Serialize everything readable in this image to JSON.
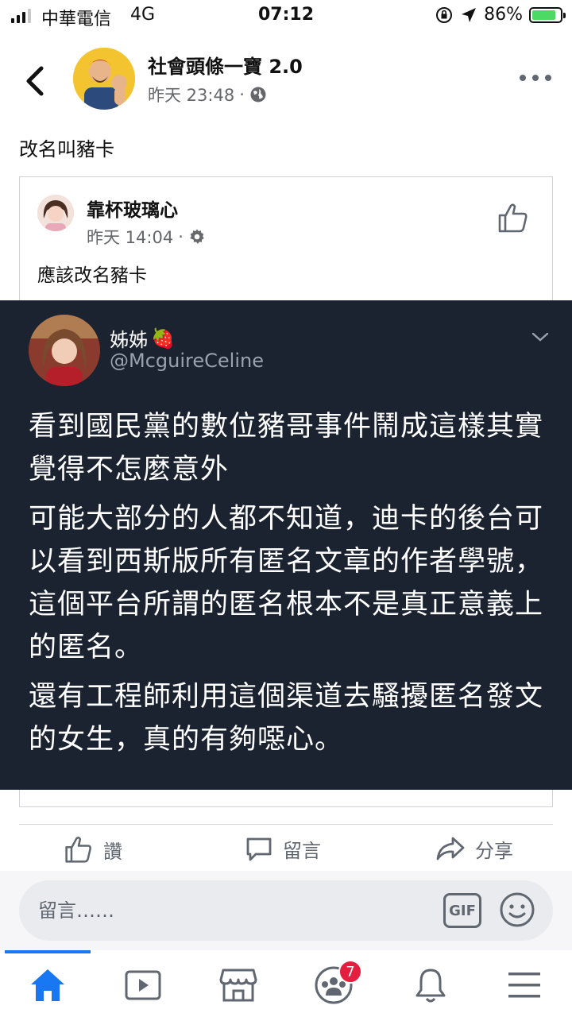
{
  "status_bar": {
    "carrier": "中華電信",
    "network": "4G",
    "time": "07:12",
    "battery_percent": "86%",
    "battery_level": 0.86,
    "signal_bars_on": 3
  },
  "post": {
    "page_name": "社會頭條一寶 2.0",
    "timestamp": "昨天 23:48",
    "separator": "·",
    "audience_icon": "globe-icon",
    "text": "改名叫豬卡"
  },
  "shared_post": {
    "author": "靠杯玻璃心",
    "timestamp": "昨天 14:04",
    "separator": "·",
    "audience_icon": "gear-icon",
    "text": "應該改名豬卡"
  },
  "tweet": {
    "display_name": "姊姊",
    "name_emoji": "🍓",
    "handle": "@McguireCeline",
    "paragraphs": [
      "看到國民黨的數位豬哥事件鬧成這樣其實覺得不怎麼意外",
      "可能大部分的人都不知道，迪卡的後台可以看到西斯版所有匿名文章的作者學號，這個平台所謂的匿名根本不是真正意義上的匿名。",
      "還有工程師利用這個渠道去騷擾匿名發文的女生，真的有夠噁心。"
    ]
  },
  "actions": {
    "like": "讚",
    "comment": "留言",
    "share": "分享"
  },
  "composer": {
    "placeholder": "留言……",
    "gif_label": "GIF"
  },
  "nav": {
    "badge_count": "7",
    "items": [
      "home-icon",
      "watch-icon",
      "marketplace-icon",
      "groups-icon",
      "notifications-icon",
      "menu-icon"
    ]
  },
  "colors": {
    "accent": "#1877f2",
    "tweet_bg": "#1b2230",
    "badge": "#e41e3f",
    "battery": "#4cd964"
  }
}
